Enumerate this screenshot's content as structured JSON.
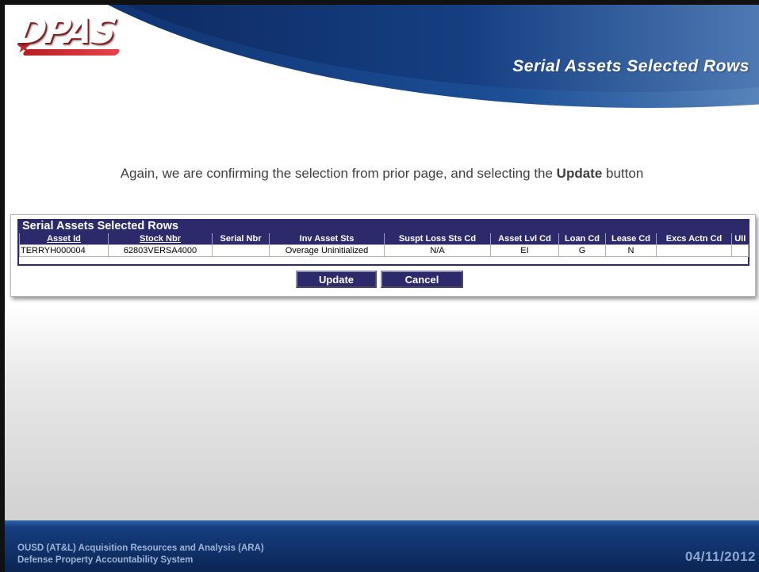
{
  "brand": {
    "logo_text": "DPAS"
  },
  "slide": {
    "title": "Serial Assets Selected Rows",
    "instruction_pre": "Again, we are confirming the selection from prior page, and selecting the ",
    "instruction_bold": "Update",
    "instruction_post": " button"
  },
  "panel": {
    "title": "Serial Assets Selected Rows",
    "columns": [
      "Asset Id",
      "Stock Nbr",
      "Serial Nbr",
      "Inv Asset Sts",
      "Suspt Loss Sts Cd",
      "Asset Lvl Cd",
      "Loan Cd",
      "Lease Cd",
      "Excs Actn Cd",
      "UII"
    ],
    "rows": [
      [
        "TERRYH000004",
        "62803VERSA4000",
        "",
        "Overage Uninitialized",
        "N/A",
        "EI",
        "G",
        "N",
        "",
        ""
      ]
    ],
    "update_label": "Update",
    "cancel_label": "Cancel"
  },
  "footer": {
    "org_line1": "OUSD (AT&L) Acquisition Resources and Analysis (ARA)",
    "org_line2": "Defense Property Accountability System",
    "date": "04/11/2012"
  },
  "colors": {
    "header_navy": "#2c2a6a",
    "banner_blue": "#153f82",
    "logo_red": "#c8232b"
  }
}
